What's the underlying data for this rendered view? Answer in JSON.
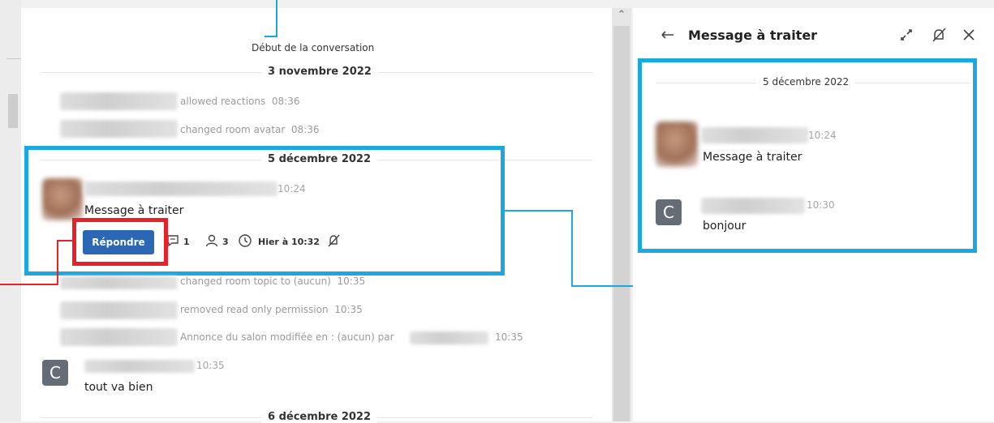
{
  "chat": {
    "start_label": "Début de la conversation",
    "days": [
      {
        "date": "3 novembre 2022"
      },
      {
        "date": "5 décembre 2022"
      },
      {
        "date": "6 décembre 2022"
      }
    ],
    "system_events": [
      {
        "text": "allowed reactions",
        "time": "08:36"
      },
      {
        "text": "changed room avatar",
        "time": "08:36"
      },
      {
        "text": "changed room topic to (aucun)",
        "time": "10:35"
      },
      {
        "text": "removed read only permission",
        "time": "10:35"
      },
      {
        "text": "Annonce du salon modifiée en : (aucun) par",
        "time": "10:35"
      }
    ],
    "highlighted_message": {
      "time": "10:24",
      "text": "Message à traiter",
      "reply_label": "Répondre",
      "reply_count": "1",
      "participants_count": "3",
      "last_reply": "Hier à 10:32"
    },
    "message_c": {
      "avatar_letter": "C",
      "time": "10:35",
      "text": "tout va bien"
    }
  },
  "thread_panel": {
    "title": "Message à traiter",
    "date": "5 décembre 2022",
    "messages": [
      {
        "time": "10:24",
        "text": "Message à traiter"
      },
      {
        "avatar_letter": "C",
        "time": "10:30",
        "text": "bonjour"
      }
    ]
  },
  "icons": [
    "back-arrow-icon",
    "expand-icon",
    "bell-off-icon",
    "close-icon",
    "reply-count-icon",
    "participants-icon",
    "clock-icon",
    "scroll-up-icon"
  ],
  "colors": {
    "highlight": "#1ba8e0",
    "callout": "#e8202a",
    "button": "#2c67b5"
  }
}
